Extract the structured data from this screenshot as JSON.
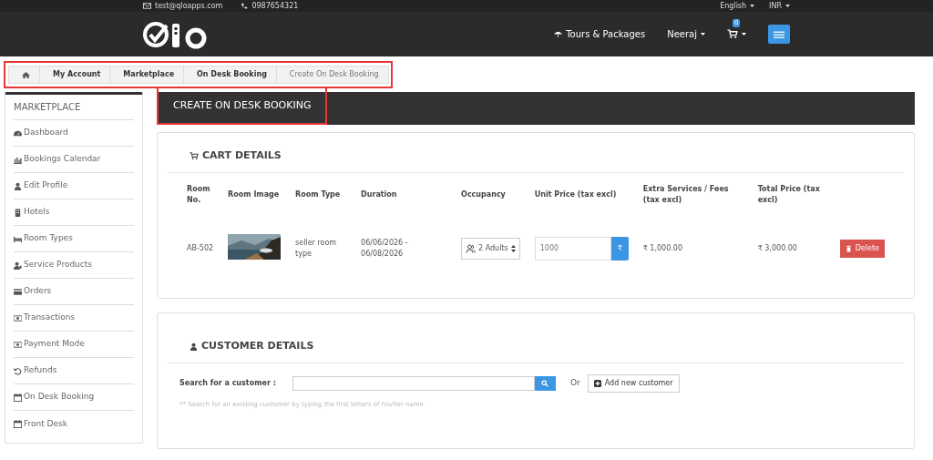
{
  "topbar": {
    "email": "test@qloapps.com",
    "phone": "0987654321",
    "language": "English",
    "currency": "INR"
  },
  "navbar": {
    "tours": "Tours & Packages",
    "user": "Neeraj",
    "cart_count": "0"
  },
  "breadcrumb": [
    {
      "label": "My Account"
    },
    {
      "label": "Marketplace"
    },
    {
      "label": "On Desk Booking"
    },
    {
      "label": "Create On Desk Booking"
    }
  ],
  "sidebar": {
    "title": "MARKETPLACE",
    "items": [
      {
        "label": "Dashboard"
      },
      {
        "label": "Bookings Calendar"
      },
      {
        "label": "Edit Profile"
      },
      {
        "label": "Hotels"
      },
      {
        "label": "Room Types"
      },
      {
        "label": "Service Products"
      },
      {
        "label": "Orders"
      },
      {
        "label": "Transactions"
      },
      {
        "label": "Payment Mode"
      },
      {
        "label": "Refunds"
      },
      {
        "label": "On Desk Booking"
      },
      {
        "label": "Front Desk"
      }
    ]
  },
  "page_title": "CREATE ON DESK BOOKING",
  "cart": {
    "title": "CART DETAILS",
    "columns": [
      "Room No.",
      "Room Image",
      "Room Type",
      "Duration",
      "Occupancy",
      "Unit Price (tax excl)",
      "Extra Services / Fees (tax excl)",
      "Total Price (tax excl)"
    ],
    "rows": [
      {
        "room_no": "AB-502",
        "room_type": "seller room type",
        "duration": "06/06/2026 - 06/08/2026",
        "occupancy": "2 Adults",
        "unit_price_placeholder": "1000",
        "currency_symbol": "₹",
        "extra": "₹ 1,000.00",
        "total": "₹ 3,000.00",
        "delete": "Delete"
      }
    ]
  },
  "customer": {
    "title": "CUSTOMER DETAILS",
    "search_label": "Search for a customer :",
    "or": "Or",
    "add_button": "Add new customer",
    "hint": "** Search for an existing customer by typing the first letters of his/her name."
  }
}
